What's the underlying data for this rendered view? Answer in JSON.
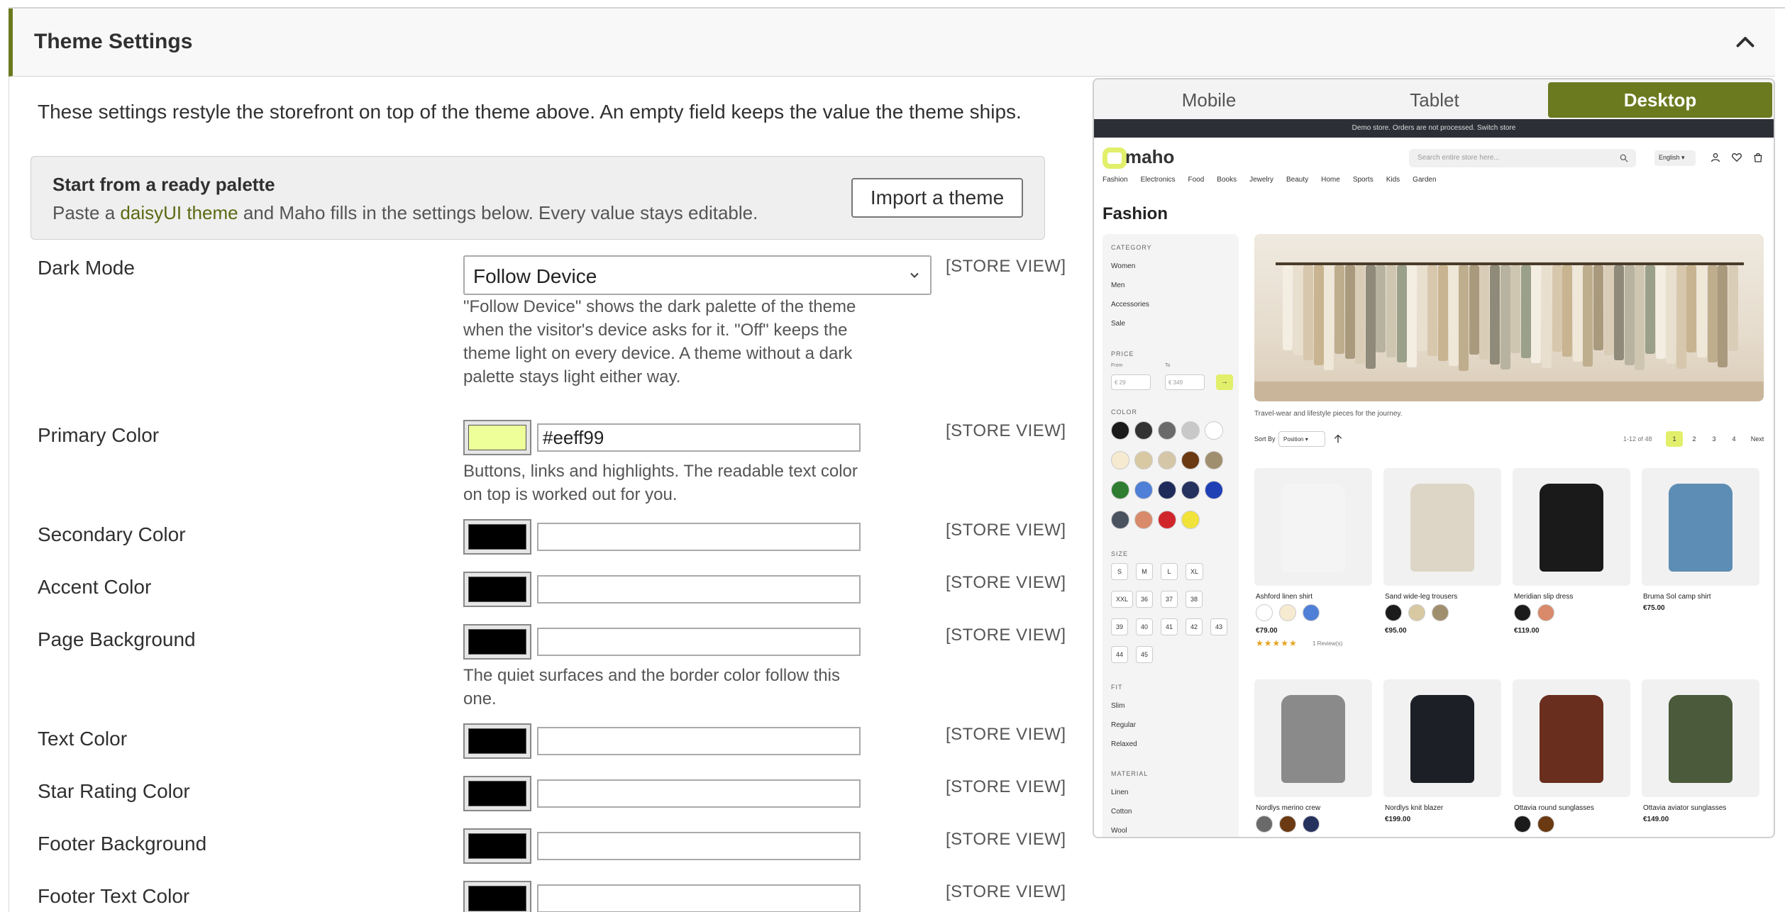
{
  "section": {
    "title": "Theme Settings"
  },
  "intro": "These settings restyle the storefront on top of the theme above. An empty field keeps the value the theme ships.",
  "palette": {
    "title": "Start from a ready palette",
    "desc_before": "Paste a ",
    "desc_link": "daisyUI theme",
    "desc_after": " and Maho fills in the settings below. Every value stays editable.",
    "import_label": "Import a theme"
  },
  "scope_label": "[STORE VIEW]",
  "dark_mode": {
    "label": "Dark Mode",
    "value": "Follow Device",
    "note": "\"Follow Device\" shows the dark palette of the theme when the visitor's device asks for it. \"Off\" keeps the theme light on every device. A theme without a dark palette stays light either way."
  },
  "colors": [
    {
      "label": "Primary Color",
      "value": "#eeff99",
      "swatch": "#eeff99",
      "note": "Buttons, links and highlights. The readable text color on top is worked out for you."
    },
    {
      "label": "Secondary Color",
      "value": "",
      "swatch": "#000000",
      "note": ""
    },
    {
      "label": "Accent Color",
      "value": "",
      "swatch": "#000000",
      "note": ""
    },
    {
      "label": "Page Background",
      "value": "",
      "swatch": "#000000",
      "note": "The quiet surfaces and the border color follow this one."
    },
    {
      "label": "Text Color",
      "value": "",
      "swatch": "#000000",
      "note": ""
    },
    {
      "label": "Star Rating Color",
      "value": "",
      "swatch": "#000000",
      "note": ""
    },
    {
      "label": "Footer Background",
      "value": "",
      "swatch": "#000000",
      "note": ""
    },
    {
      "label": "Footer Text Color",
      "value": "",
      "swatch": "#000000",
      "note": ""
    }
  ],
  "preview": {
    "tabs": [
      "Mobile",
      "Tablet",
      "Desktop"
    ],
    "active_tab": "Desktop",
    "accent": "#6b7a1f",
    "store": {
      "demo_bar": "Demo store. Orders are not processed. Switch store",
      "logo": "maho",
      "search_placeholder": "Search entire store here...",
      "language": "English",
      "nav": [
        "Fashion",
        "Electronics",
        "Food",
        "Books",
        "Jewelry",
        "Beauty",
        "Home",
        "Sports",
        "Kids",
        "Garden"
      ],
      "page_title": "Fashion",
      "filters": {
        "category_head": "CATEGORY",
        "categories": [
          "Women",
          "Men",
          "Accessories",
          "Sale"
        ],
        "price_head": "PRICE",
        "price_from_label": "From",
        "price_to_label": "To",
        "price_from": "€  29",
        "price_to": "€  349",
        "price_go": "→",
        "color_head": "COLOR",
        "color_swatches": [
          "#1b1b1b",
          "#333333",
          "#6a6a6a",
          "#c8c8c8",
          "#ffffff",
          "#f6ead0",
          "#d8c9a3",
          "#d5c6a8",
          "#6b3a12",
          "#a08f6e",
          "#2e7d32",
          "#4f7fd6",
          "#1e2b5a",
          "#26325e",
          "#1f3fb5",
          "#4a5260",
          "#d98a6a",
          "#d0252b",
          "#f2e33a"
        ],
        "size_head": "SIZE",
        "sizes": [
          "S",
          "M",
          "L",
          "XL",
          "XXL",
          "36",
          "37",
          "38",
          "39",
          "40",
          "41",
          "42",
          "43",
          "44",
          "45"
        ],
        "fit_head": "FIT",
        "fits": [
          "Slim",
          "Regular",
          "Relaxed"
        ],
        "material_head": "MATERIAL",
        "materials": [
          "Linen",
          "Cotton",
          "Wool"
        ]
      },
      "tagline": "Travel-wear and lifestyle pieces for the journey.",
      "sort_by": "Sort By",
      "sort_value": "Position",
      "pager_count": "1-12 of 48",
      "pages": [
        "1",
        "2",
        "3",
        "4"
      ],
      "next": "Next",
      "products": [
        {
          "name": "Ashford linen shirt",
          "price": "€79.00",
          "colors": [
            "#ffffff",
            "#f6ead0",
            "#4f7fd6"
          ],
          "rating_stars": "★★★★★",
          "reviews": "1 Review(s)",
          "img": "#f4f4f4"
        },
        {
          "name": "Sand wide-leg trousers",
          "price": "€95.00",
          "colors": [
            "#1b1b1b",
            "#d8c9a3",
            "#a08f6e"
          ],
          "img": "#ddd6c6"
        },
        {
          "name": "Meridian slip dress",
          "price": "€119.00",
          "colors": [
            "#1b1b1b",
            "#d98a6a"
          ],
          "img": "#1a1a1a"
        },
        {
          "name": "Bruma Sol camp shirt",
          "price": "€75.00",
          "colors": [],
          "img": "#5d8db5"
        },
        {
          "name": "Nordlys merino crew",
          "price": "",
          "colors": [
            "#6a6a6a",
            "#6b3a12",
            "#26325e"
          ],
          "img": "#8a8a8a"
        },
        {
          "name": "Nordlys knit blazer",
          "price": "€199.00",
          "colors": [],
          "img": "#1c1f26"
        },
        {
          "name": "Ottavia round sunglasses",
          "price": "",
          "colors": [
            "#1b1b1b",
            "#6b3a12"
          ],
          "img": "#6a2e1e"
        },
        {
          "name": "Ottavia aviator sunglasses",
          "price": "€149.00",
          "colors": [],
          "img": "#4a5a3a"
        }
      ]
    }
  }
}
